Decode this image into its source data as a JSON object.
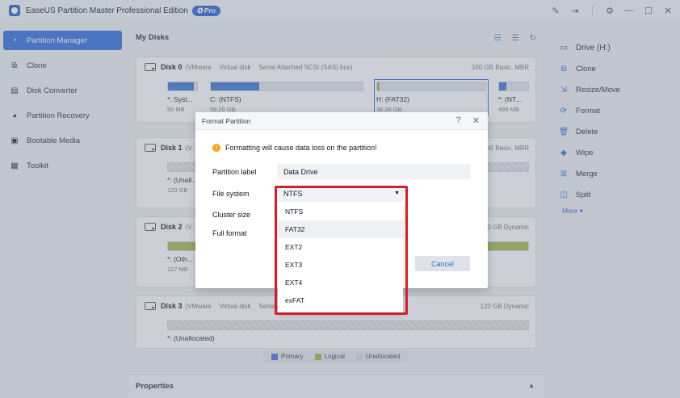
{
  "app": {
    "title": "EaseUS Partition Master Professional Edition",
    "badge": "Pro",
    "window_controls": [
      "feedback-icon",
      "sign-in-icon",
      "settings-icon",
      "minimize-icon",
      "maximize-icon",
      "close-icon"
    ]
  },
  "sidebar": {
    "items": [
      {
        "label": "Partition Manager",
        "icon": "partition-manager-icon",
        "active": true
      },
      {
        "label": "Clone",
        "icon": "clone-icon"
      },
      {
        "label": "Disk Converter",
        "icon": "disk-converter-icon"
      },
      {
        "label": "Partition Recovery",
        "icon": "partition-recovery-icon"
      },
      {
        "label": "Bootable Media",
        "icon": "bootable-media-icon"
      },
      {
        "label": "Toolkit",
        "icon": "toolkit-icon"
      }
    ]
  },
  "main": {
    "title": "My Disks",
    "disks": [
      {
        "name": "Disk 0",
        "meta": [
          "(VMware",
          "Virtual disk",
          "Serial Attached SCSI (SAS) bus)"
        ],
        "right": "100 GB Basic, MBR",
        "partitions": [
          {
            "label": "*: Syst...",
            "size": "50 MB",
            "fill": 0.9
          },
          {
            "label": "C: (NTFS)",
            "size": "59.20 GB",
            "fill": 0.32
          },
          {
            "label": "H: (FAT32)",
            "size": "38.36 GB",
            "fill": 0.02,
            "selected": true
          },
          {
            "label": "*: (NT...",
            "size": "499 MB",
            "fill": 0.25
          }
        ]
      },
      {
        "name": "Disk 1",
        "meta": [
          "(V..."
        ],
        "right": "SAS) bus)  120 GB Basic, MBR",
        "partitions": [
          {
            "label": "*: (Unall...",
            "size": "120 GB"
          }
        ]
      },
      {
        "name": "Disk 2",
        "meta": [
          "(V..."
        ],
        "right": "0 GB Dynamic",
        "partitions": [
          {
            "label": "*: (Oth...",
            "size": "127 MB"
          }
        ]
      },
      {
        "name": "Disk 3",
        "meta": [
          "(VMware",
          "Virtual disk",
          "Serial Attached SCSI (SAS) bus)"
        ],
        "right": "120 GB Dynamic",
        "partitions": [
          {
            "label": "*: (Unallocated)",
            "size": ""
          }
        ]
      }
    ],
    "legend": {
      "primary": "Primary",
      "logical": "Logical",
      "unallocated": "Unallocated"
    },
    "properties": "Properties"
  },
  "right_panel": {
    "drive": "Drive (H:)",
    "actions": [
      "Clone",
      "Resize/Move",
      "Format",
      "Delete",
      "Wipe",
      "Merge",
      "Split"
    ],
    "more": "More"
  },
  "dialog": {
    "title": "Format Partition",
    "warning": "Formatting will cause data loss on the partition!",
    "partition_label_label": "Partition label",
    "partition_label_value": "Data Drive",
    "file_system_label": "File system",
    "file_system_value": "NTFS",
    "cluster_size_label": "Cluster size",
    "full_format_label": "Full format",
    "cancel": "Cancel",
    "fs_options": [
      "NTFS",
      "FAT32",
      "EXT2",
      "EXT3",
      "EXT4",
      "exFAT"
    ],
    "hover_option": "FAT32"
  },
  "colors": {
    "accent": "#2f6fde",
    "primary_partition": "#3f73d4",
    "logical_partition": "#a3b94a",
    "highlight": "#d21f2c",
    "warning": "#f5a60a"
  }
}
